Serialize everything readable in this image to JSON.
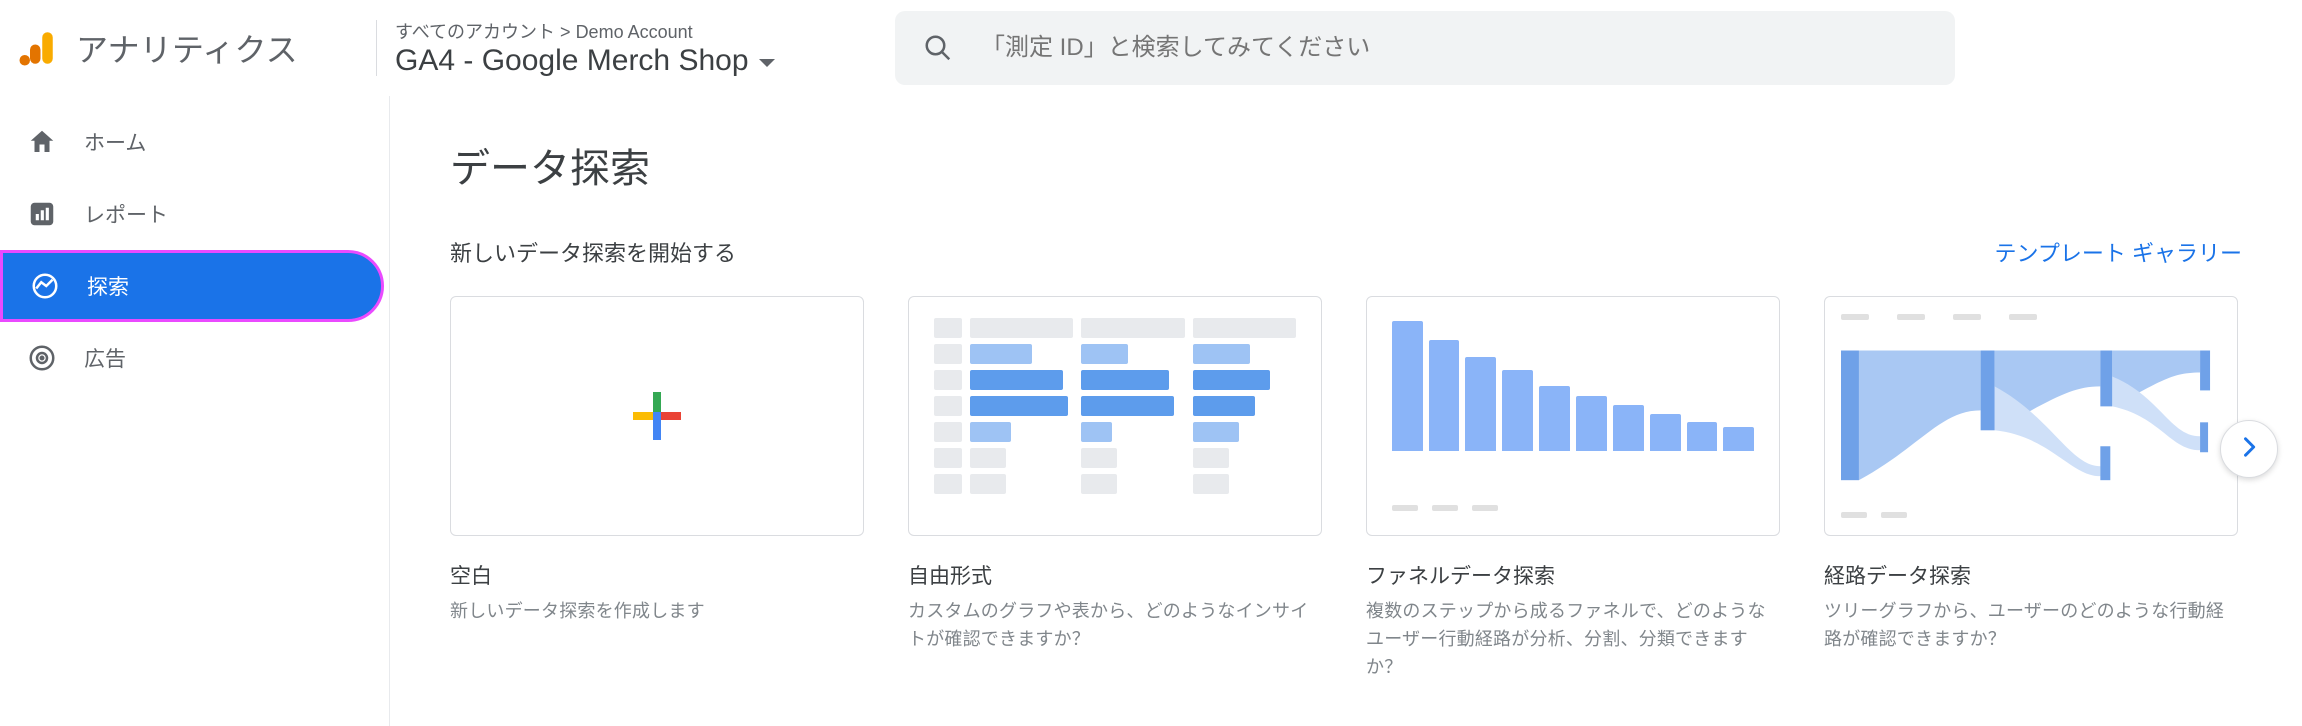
{
  "header": {
    "app_title": "アナリティクス",
    "breadcrumb_prefix": "すべてのアカウント",
    "breadcrumb_account": "Demo Account",
    "property_name": "GA4 - Google Merch Shop",
    "search_placeholder": "「測定 ID」と検索してみてください"
  },
  "sidebar": {
    "items": [
      {
        "label": "ホーム",
        "icon": "home-icon",
        "selected": false
      },
      {
        "label": "レポート",
        "icon": "bar-chart-icon",
        "selected": false
      },
      {
        "label": "探索",
        "icon": "explore-icon",
        "selected": true
      },
      {
        "label": "広告",
        "icon": "target-icon",
        "selected": false
      }
    ]
  },
  "main": {
    "page_title": "データ探索",
    "sub_title": "新しいデータ探索を開始する",
    "gallery_link": "テンプレート ギャラリー",
    "cards": [
      {
        "title": "空白",
        "desc": "新しいデータ探索を作成します",
        "kind": "blank"
      },
      {
        "title": "自由形式",
        "desc": "カスタムのグラフや表から、どのようなインサイトが確認できますか？",
        "kind": "freeform"
      },
      {
        "title": "ファネルデータ探索",
        "desc": "複数のステップから成るファネルで、どのようなユーザー行動経路が分析、分割、分類できますか？",
        "kind": "funnel"
      },
      {
        "title": "経路データ探索",
        "desc": "ツリーグラフから、ユーザーのどのような行動経路が確認できますか？",
        "kind": "path"
      }
    ]
  }
}
